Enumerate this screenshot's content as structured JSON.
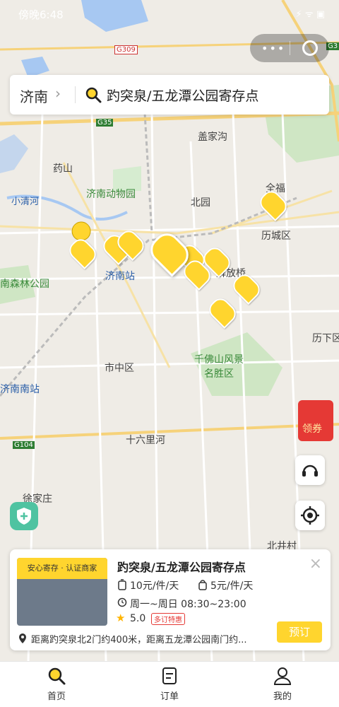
{
  "status_bar": {
    "time": "傍晚6:48",
    "icons": "⚡ ᯤ ▣"
  },
  "search": {
    "city": "济南",
    "query": "趵突泉/五龙潭公园寄存点"
  },
  "map_labels": {
    "gaijiagou": "盖家沟",
    "yaoshan": "药山",
    "zoo": "济南动物园",
    "xiaoqinghe": "小清河",
    "beiyuan": "北园",
    "quanfu": "全福",
    "lichengqu": "历城区",
    "jinan_station": "济南站",
    "forest_park": "南森林公园",
    "jiefangqiao": "解放桥",
    "lixia": "历下区",
    "qianfoshan": "千佛山风景名胜区",
    "shizhongqu": "市中区",
    "south_station": "济南南站",
    "shiliuli": "十六里河",
    "xujiazhuang": "徐家庄",
    "beijingcun": "北井村",
    "road_g309": "G309",
    "road_g35": "G35",
    "road_g104": "G104",
    "road_g3": "G3"
  },
  "coupon": {
    "label": "领券"
  },
  "card": {
    "badge": "安心寄存 · 认证商家",
    "title": "趵突泉/五龙潭公园寄存点",
    "price_large": "10元/件/天",
    "price_small": "5元/件/天",
    "hours": "周一~周日 08:30~23:00",
    "rating": "5.0",
    "rating_tag": "多订特惠",
    "address": "距离趵突泉北2门约400米，距离五龙潭公园南门约...",
    "book_label": "预订",
    "close": "×"
  },
  "tabs": [
    {
      "label": "首页",
      "icon": "search-icon",
      "active": true
    },
    {
      "label": "订单",
      "icon": "order-icon",
      "active": false
    },
    {
      "label": "我的",
      "icon": "profile-icon",
      "active": false
    }
  ],
  "colors": {
    "accent": "#ffd52e",
    "coupon": "#e53935",
    "shield": "#4fc3a1"
  }
}
